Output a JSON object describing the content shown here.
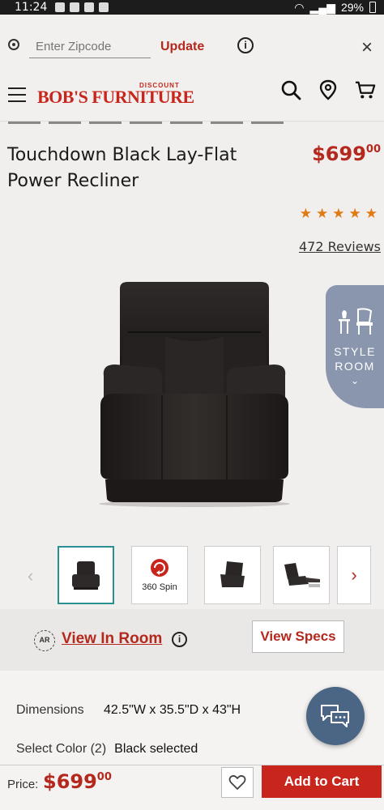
{
  "status_bar": {
    "time": "11:24",
    "battery": "29%"
  },
  "zip_bar": {
    "placeholder": "Enter Zipcode",
    "update_label": "Update",
    "info_glyph": "i",
    "close_glyph": "×"
  },
  "header": {
    "logo_main": "BOB'S FURNITURE",
    "logo_discount": "DISCOUNT",
    "icons": [
      "menu-icon",
      "search-icon",
      "location-pin-icon",
      "cart-icon"
    ]
  },
  "product": {
    "title": "Touchdown Black Lay-Flat Power Recliner",
    "price_dollars": "$699",
    "price_cents": "00",
    "rating_stars": 5,
    "reviews": "472 Reviews"
  },
  "style_room": {
    "line1": "STYLE",
    "line2": "ROOM"
  },
  "thumbnails": {
    "spin_label": "360 Spin"
  },
  "view_in_room": {
    "ar_label": "AR",
    "link": "View In Room",
    "info_glyph": "i",
    "specs_button": "View Specs"
  },
  "details": {
    "dimensions_label": "Dimensions",
    "dimensions_value": "42.5\"W x 35.5\"D x 43\"H",
    "color_label": "Select Color (2)",
    "color_value": "Black selected"
  },
  "bottom_bar": {
    "price_label": "Price:",
    "price_dollars": "$699",
    "price_cents": "00",
    "add_to_cart": "Add to Cart"
  },
  "colors": {
    "brand_red": "#c8261c",
    "accent_teal": "#2a8f8f",
    "star_orange": "#e07a12",
    "chat_blue": "#4b6585",
    "style_room_blue": "#8a96ad"
  }
}
